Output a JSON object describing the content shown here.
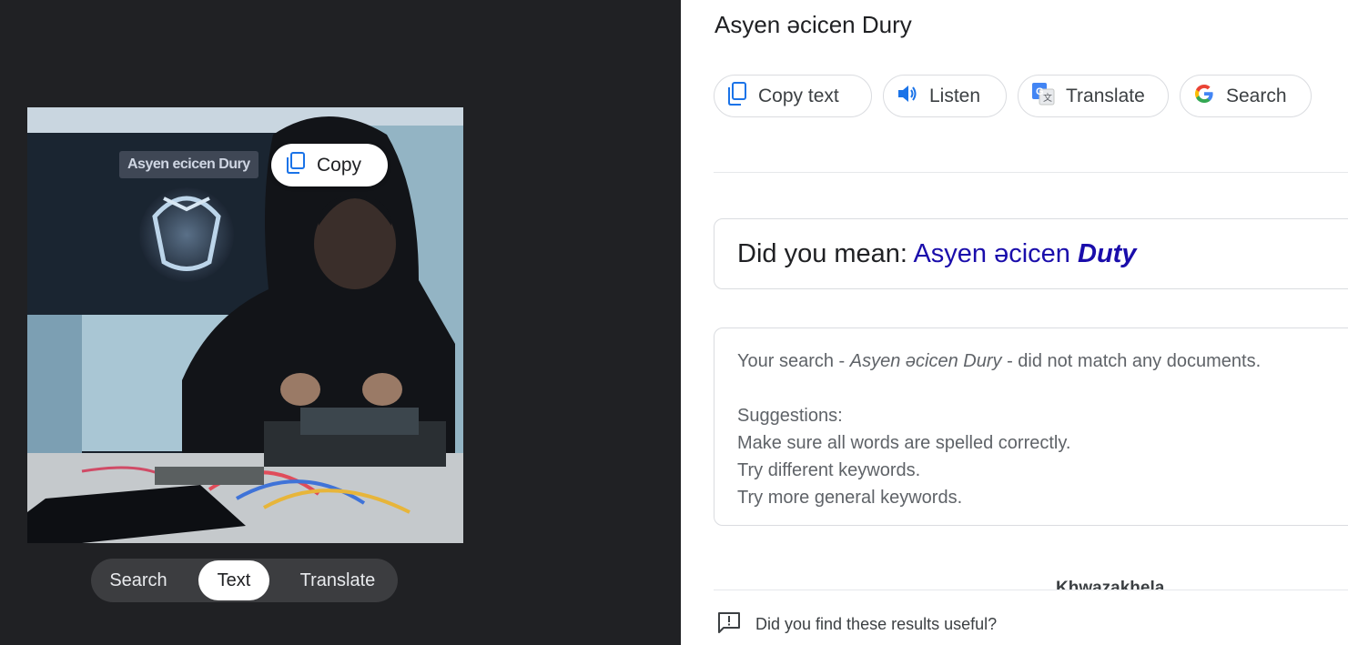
{
  "left_panel": {
    "ocr_text_overlay": "Asyen ecicen Dury",
    "copy_bubble_label": "Copy",
    "modes": [
      "Search",
      "Text",
      "Translate"
    ],
    "active_mode": "Text"
  },
  "right_panel": {
    "title": "Asyen əcicen Dury",
    "actions": [
      {
        "label": "Copy text",
        "icon": "copy-icon"
      },
      {
        "label": "Listen",
        "icon": "speaker-icon"
      },
      {
        "label": "Translate",
        "icon": "google-translate-icon"
      },
      {
        "label": "Search",
        "icon": "google-g-icon"
      }
    ],
    "did_you_mean": {
      "prefix": "Did you mean: ",
      "plain": "Asyen əcicen ",
      "corrected": "Duty"
    },
    "no_results": {
      "prefix": "Your search - ",
      "query": "Asyen əcicen Dury",
      "suffix": " - did not match any documents.",
      "suggestions_heading": "Suggestions:",
      "suggestions": [
        "Make sure all words are spelled correctly.",
        "Try different keywords.",
        "Try more general keywords."
      ]
    },
    "clipped_result_title": "Khwazakhela",
    "feedback_prompt": "Did you find these results useful?"
  },
  "colors": {
    "left_bg": "#202124",
    "link_blue": "#1a0dab",
    "google_blue": "#4285f4",
    "google_red": "#ea4335",
    "google_yellow": "#fbbc05",
    "google_green": "#34a853"
  }
}
